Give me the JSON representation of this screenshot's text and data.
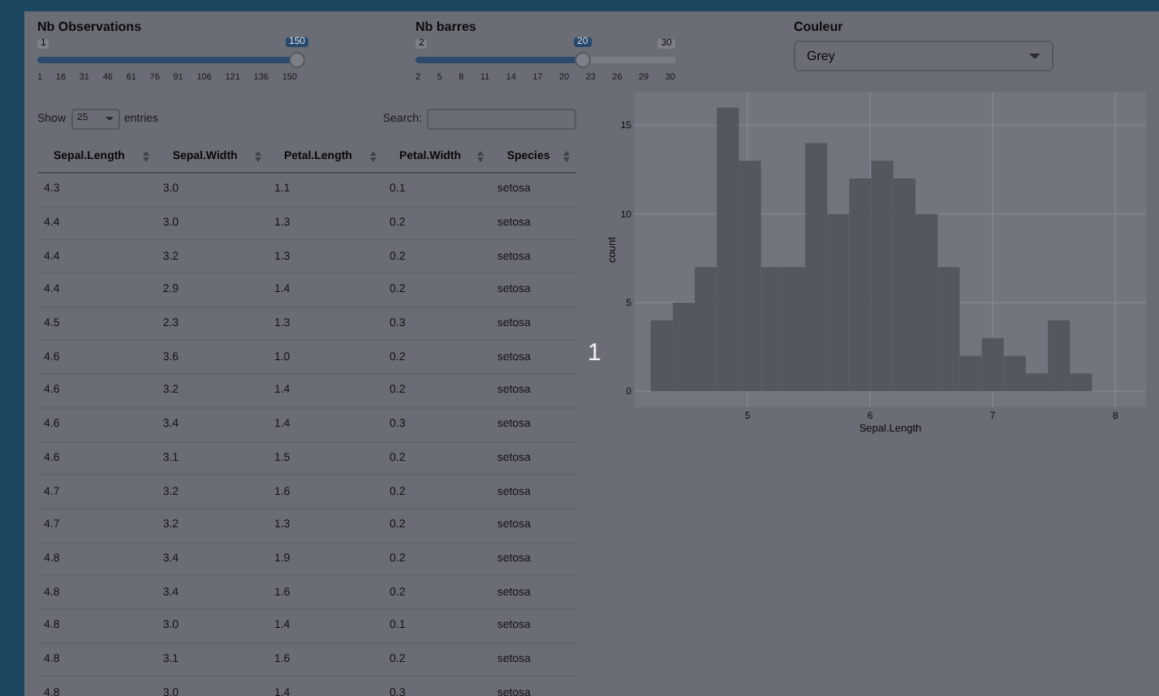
{
  "sliders": [
    {
      "label": "Nb Observations",
      "min": "1",
      "value": "150",
      "level": 1,
      "ticks": [
        "1",
        "16",
        "31",
        "46",
        "61",
        "76",
        "91",
        "106",
        "121",
        "136",
        "150"
      ]
    },
    {
      "label": "Nb barres",
      "min": "2",
      "max": "30",
      "value": "20",
      "level": 0.643,
      "ticks": [
        "2",
        "5",
        "8",
        "11",
        "14",
        "17",
        "20",
        "23",
        "26",
        "29",
        "30"
      ]
    }
  ],
  "color_select": {
    "label": "Couleur",
    "value": "Grey"
  },
  "table_controls": {
    "show_label": "Show",
    "page_size": "25",
    "entries_label": "entries",
    "search_label": "Search:"
  },
  "table": {
    "columns": [
      "Sepal.Length",
      "Sepal.Width",
      "Petal.Length",
      "Petal.Width",
      "Species"
    ],
    "rows": [
      [
        "4.3",
        "3.0",
        "1.1",
        "0.1",
        "setosa"
      ],
      [
        "4.4",
        "3.0",
        "1.3",
        "0.2",
        "setosa"
      ],
      [
        "4.4",
        "3.2",
        "1.3",
        "0.2",
        "setosa"
      ],
      [
        "4.4",
        "2.9",
        "1.4",
        "0.2",
        "setosa"
      ],
      [
        "4.5",
        "2.3",
        "1.3",
        "0.3",
        "setosa"
      ],
      [
        "4.6",
        "3.6",
        "1.0",
        "0.2",
        "setosa"
      ],
      [
        "4.6",
        "3.2",
        "1.4",
        "0.2",
        "setosa"
      ],
      [
        "4.6",
        "3.4",
        "1.4",
        "0.3",
        "setosa"
      ],
      [
        "4.6",
        "3.1",
        "1.5",
        "0.2",
        "setosa"
      ],
      [
        "4.7",
        "3.2",
        "1.6",
        "0.2",
        "setosa"
      ],
      [
        "4.7",
        "3.2",
        "1.3",
        "0.2",
        "setosa"
      ],
      [
        "4.8",
        "3.4",
        "1.9",
        "0.2",
        "setosa"
      ],
      [
        "4.8",
        "3.4",
        "1.6",
        "0.2",
        "setosa"
      ],
      [
        "4.8",
        "3.0",
        "1.4",
        "0.1",
        "setosa"
      ],
      [
        "4.8",
        "3.1",
        "1.6",
        "0.2",
        "setosa"
      ],
      [
        "4.8",
        "3.0",
        "1.4",
        "0.3",
        "setosa"
      ]
    ]
  },
  "overlay_text": "1",
  "histogram": {
    "chart_data": {
      "type": "bar",
      "xlabel": "Sepal.Length",
      "ylabel": "count",
      "x": [
        4.3,
        4.48,
        4.66,
        4.84,
        5.02,
        5.2,
        5.38,
        5.56,
        5.74,
        5.92,
        6.1,
        6.28,
        6.46,
        6.64,
        6.82,
        7.0,
        7.18,
        7.36,
        7.54,
        7.72
      ],
      "values": [
        4,
        5,
        7,
        16,
        13,
        7,
        7,
        14,
        10,
        12,
        13,
        12,
        10,
        7,
        2,
        3,
        2,
        1,
        4,
        1
      ],
      "grid": true,
      "xlim": [
        4.08,
        8.25
      ],
      "ylim": [
        -0.9,
        16.85
      ],
      "xticks": [
        5,
        6,
        7,
        8
      ],
      "yticks": [
        0,
        5,
        10,
        15
      ]
    }
  }
}
